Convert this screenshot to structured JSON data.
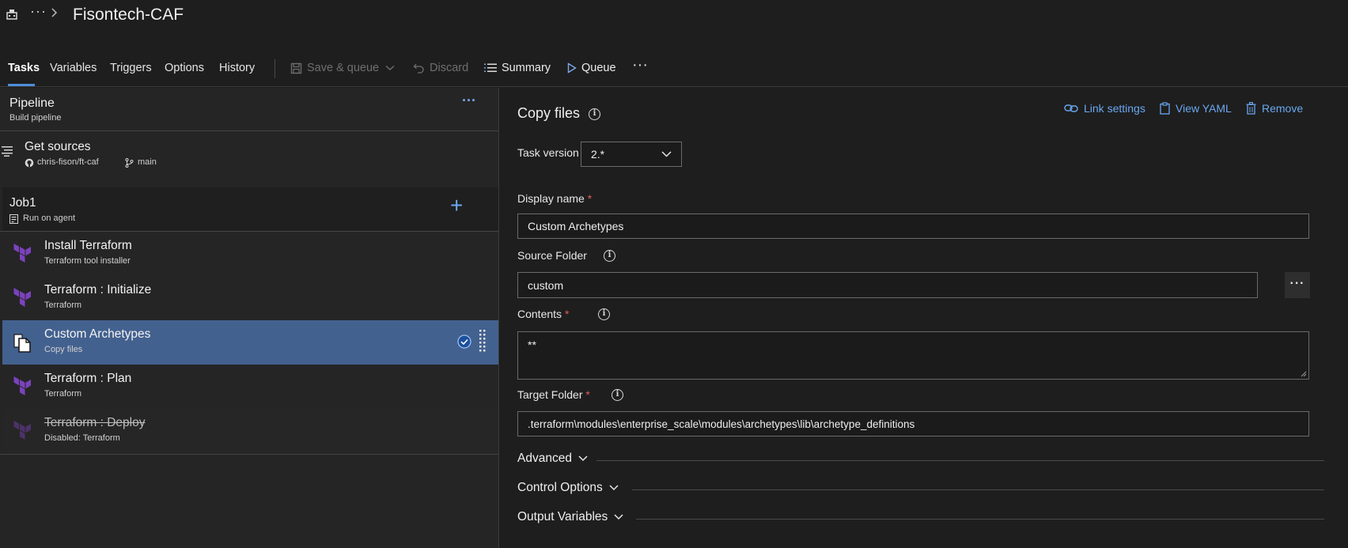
{
  "header": {
    "logo_icon": "pipeline-icon",
    "more_label": "···",
    "title": "Fisontech-CAF"
  },
  "toolbar": {
    "tabs": [
      {
        "label": "Tasks",
        "active": true
      },
      {
        "label": "Variables"
      },
      {
        "label": "Triggers"
      },
      {
        "label": "Options"
      },
      {
        "label": "History"
      }
    ],
    "save_queue_label": "Save & queue",
    "discard_label": "Discard",
    "summary_label": "Summary",
    "queue_label": "Queue",
    "more_label": "···"
  },
  "pipeline": {
    "title": "Pipeline",
    "subtitle": "Build pipeline",
    "more_label": "···"
  },
  "get_sources": {
    "title": "Get sources",
    "repo": "chris-fison/ft-caf",
    "branch": "main"
  },
  "job": {
    "title": "Job1",
    "subtitle": "Run on agent",
    "add_label": "+"
  },
  "tasks": [
    {
      "title": "Install Terraform",
      "subtitle": "Terraform tool installer",
      "icon": "terraform-icon"
    },
    {
      "title": "Terraform : Initialize",
      "subtitle": "Terraform",
      "icon": "terraform-icon"
    },
    {
      "title": "Custom Archetypes",
      "subtitle": "Copy files",
      "icon": "copy-files-icon",
      "selected": true
    },
    {
      "title": "Terraform : Plan",
      "subtitle": "Terraform",
      "icon": "terraform-icon"
    },
    {
      "title": "Terraform : Deploy",
      "subtitle": "Disabled: Terraform",
      "icon": "terraform-icon",
      "disabled": true
    }
  ],
  "detail": {
    "title": "Copy files",
    "link_settings_label": "Link settings",
    "view_yaml_label": "View YAML",
    "remove_label": "Remove",
    "task_version_label": "Task version",
    "task_version_value": "2.*",
    "display_name_label": "Display name",
    "display_name_value": "Custom Archetypes",
    "source_folder_label": "Source Folder",
    "source_folder_value": "custom",
    "browse_label": "···",
    "contents_label": "Contents",
    "contents_value": "**",
    "target_folder_label": "Target Folder",
    "target_folder_value": ".terraform\\modules\\enterprise_scale\\modules\\archetypes\\lib\\archetype_definitions",
    "required_mark": "*",
    "sections": [
      "Advanced",
      "Control Options",
      "Output Variables"
    ]
  },
  "colors": {
    "accent": "#4e8ddb",
    "link": "#6aa7f0",
    "selected_row": "#43618f",
    "terraform": "#7b42bc",
    "required": "#e05a5a"
  }
}
